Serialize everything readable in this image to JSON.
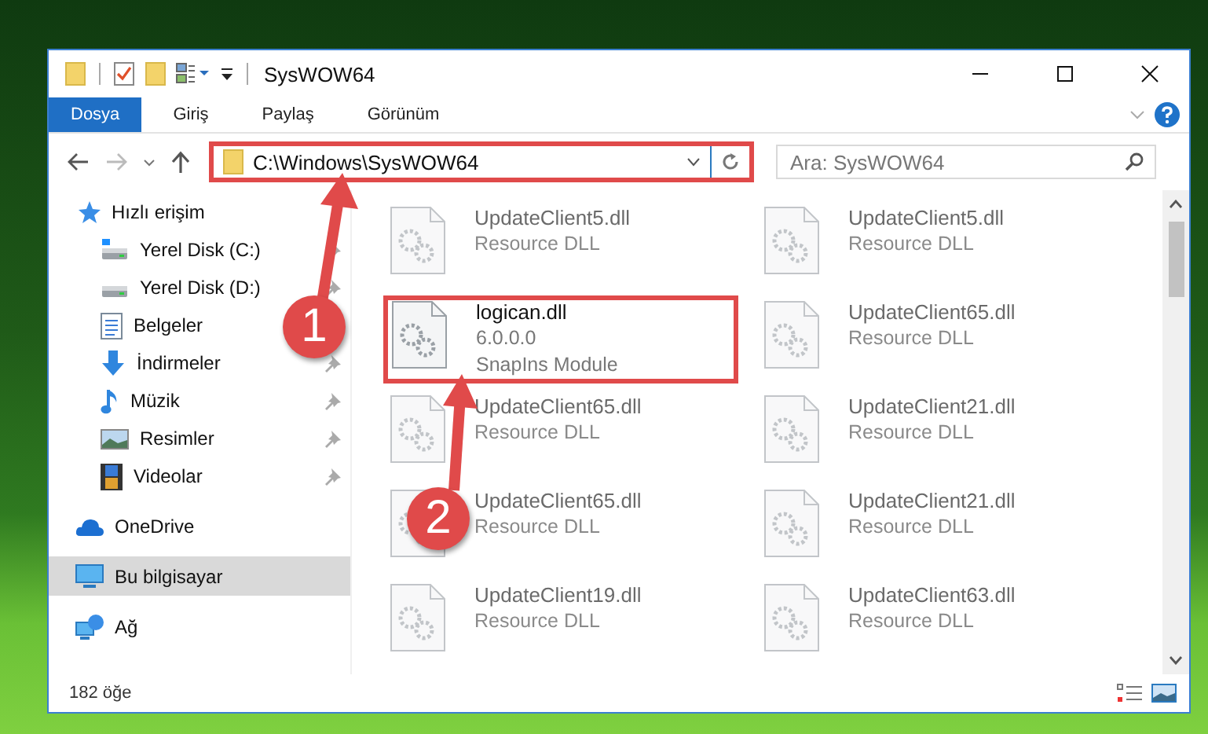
{
  "window": {
    "title": "SysWOW64"
  },
  "ribbon_tabs": [
    {
      "label": "Dosya",
      "selected": true
    },
    {
      "label": "Giriş",
      "selected": false
    },
    {
      "label": "Paylaş",
      "selected": false
    },
    {
      "label": "Görünüm",
      "selected": false
    }
  ],
  "address": {
    "path": "C:\\Windows\\SysWOW64",
    "highlighted": true
  },
  "search": {
    "placeholder": "Ara: SysWOW64"
  },
  "quick_access": {
    "label": "Hızlı erişim",
    "children": [
      {
        "label": "Yerel Disk (C:)",
        "kind": "system-drive",
        "pinned": true
      },
      {
        "label": "Yerel Disk (D:)",
        "kind": "drive",
        "pinned": true
      },
      {
        "label": "Belgeler",
        "kind": "documents"
      },
      {
        "label": "İndirmeler",
        "kind": "downloads",
        "pinned": true
      },
      {
        "label": "Müzik",
        "kind": "music",
        "pinned": true
      },
      {
        "label": "Resimler",
        "kind": "pictures",
        "pinned": true
      },
      {
        "label": "Videolar",
        "kind": "videos",
        "pinned": true
      }
    ]
  },
  "sidebar_items": [
    {
      "label": "OneDrive",
      "kind": "cloud",
      "selected": false
    },
    {
      "label": "Bu bilgisayar",
      "kind": "computer",
      "selected": true
    },
    {
      "label": "Ağ",
      "kind": "network",
      "selected": false
    }
  ],
  "files": [
    {
      "name": "UpdateClient5.dll",
      "lines": [
        "Resource DLL"
      ],
      "blurred": true,
      "highlighted": false
    },
    {
      "name": "UpdateClient5.dll",
      "lines": [
        "Resource DLL"
      ],
      "blurred": true,
      "highlighted": false
    },
    {
      "name": "logican.dll",
      "lines": [
        "6.0.0.0",
        "SnapIns Module"
      ],
      "blurred": false,
      "highlighted": true
    },
    {
      "name": "UpdateClient65.dll",
      "lines": [
        "Resource DLL"
      ],
      "blurred": true,
      "highlighted": false
    },
    {
      "name": "UpdateClient65.dll",
      "lines": [
        "Resource DLL"
      ],
      "blurred": true,
      "highlighted": false
    },
    {
      "name": "UpdateClient21.dll",
      "lines": [
        "Resource DLL"
      ],
      "blurred": true,
      "highlighted": false
    },
    {
      "name": "UpdateClient65.dll",
      "lines": [
        "Resource DLL"
      ],
      "blurred": true,
      "highlighted": false
    },
    {
      "name": "UpdateClient21.dll",
      "lines": [
        "Resource DLL"
      ],
      "blurred": true,
      "highlighted": false
    },
    {
      "name": "UpdateClient19.dll",
      "lines": [
        "Resource DLL"
      ],
      "blurred": true,
      "highlighted": false
    },
    {
      "name": "UpdateClient63.dll",
      "lines": [
        "Resource DLL"
      ],
      "blurred": true,
      "highlighted": false
    }
  ],
  "status_bar": {
    "count": "182 öğe"
  },
  "callouts": [
    {
      "number": "1"
    },
    {
      "number": "2"
    }
  ]
}
